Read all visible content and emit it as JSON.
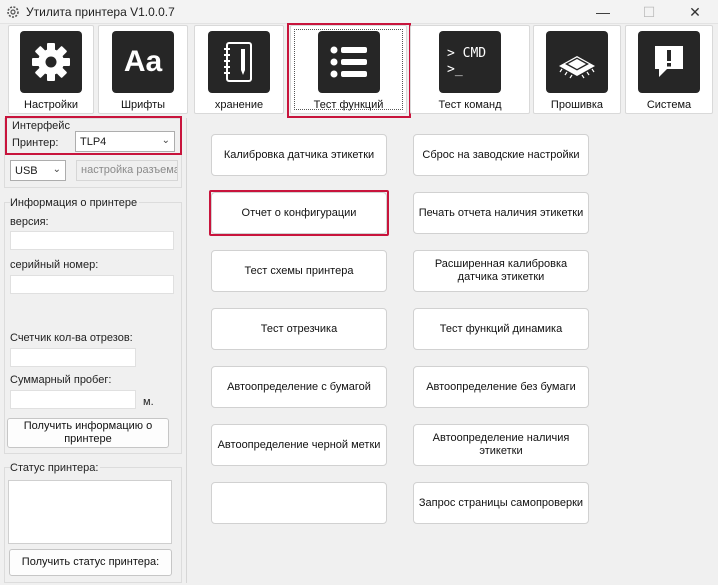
{
  "window": {
    "title": "Утилита принтера  V1.0.0.7",
    "minimize": "—",
    "maximize": "☐",
    "close": "✕"
  },
  "toolbar": {
    "tabs": [
      {
        "label": "Настройки",
        "icon": "gear-icon"
      },
      {
        "label": "Шрифты",
        "icon": "font-icon",
        "glyph": "Aa"
      },
      {
        "label": "хранение",
        "icon": "notebook-icon"
      },
      {
        "label": "Тест функций",
        "icon": "list-icon",
        "active": true
      },
      {
        "label": "Тест команд",
        "icon": "terminal-icon",
        "glyph1": "> CMD",
        "glyph2": ">_"
      },
      {
        "label": "Прошивка",
        "icon": "chip-icon"
      },
      {
        "label": "Система",
        "icon": "alert-icon",
        "glyph": "!"
      }
    ]
  },
  "interface": {
    "title": "Интерфейс",
    "printer_label": "Принтер:",
    "printer_value": "TLP4",
    "port_value": "USB",
    "port_settings": "настройка разъема"
  },
  "printer_info": {
    "title": "Информация о принтере",
    "version_label": "версия:",
    "serial_label": "серийный номер:",
    "cutter_label": "Счетчик кол-ва отрезов:",
    "mileage_label": "Суммарный пробег:",
    "mileage_unit": "м.",
    "get_info_button": "Получить информацию о принтере"
  },
  "printer_status": {
    "title": "Статус принтера:",
    "get_status_button": "Получить статус принтера:"
  },
  "functions": [
    "Калибровка датчика этикетки",
    "Сброс на заводские настройки",
    "Отчет о конфигурации",
    "Печать отчета наличия этикетки",
    "Тест схемы принтера",
    "Расширенная калибровка датчика этикетки",
    "Тест отрезчика",
    "Тест функций динамика",
    "Автоопределение с бумагой",
    "Автоопределение без бумаги",
    "Автоопределение черной метки",
    "Автоопределение наличия этикетки",
    "",
    "Запрос страницы самопроверки"
  ],
  "colors": {
    "highlight": "#c8143c",
    "icon_bg": "#262626"
  }
}
